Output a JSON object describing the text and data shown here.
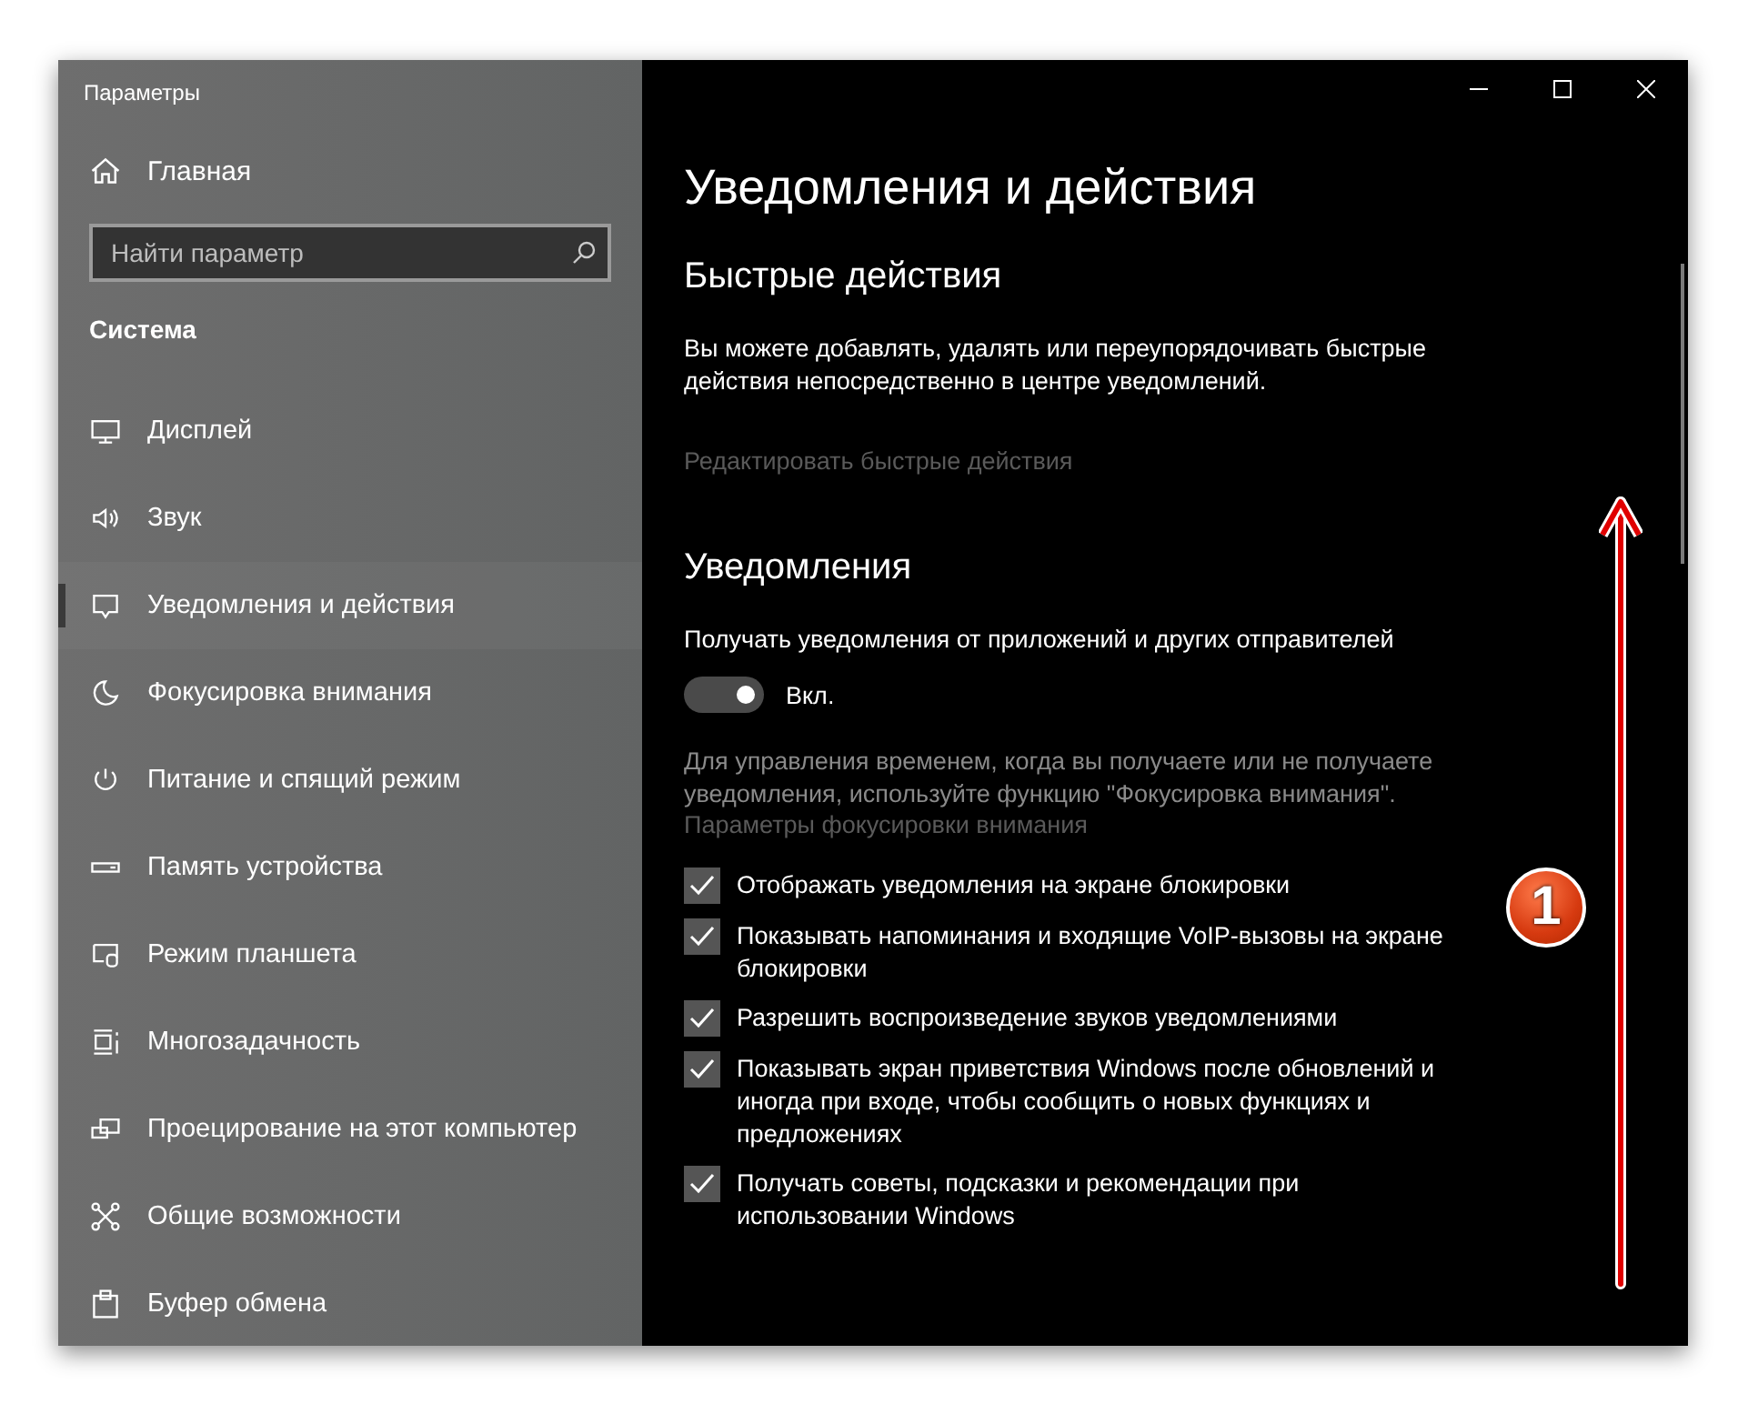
{
  "window": {
    "title": "Параметры"
  },
  "sidebar": {
    "home": "Главная",
    "search": {
      "placeholder": "Найти параметр"
    },
    "section": "Система",
    "items": [
      {
        "label": "Дисплей",
        "selected": false
      },
      {
        "label": "Звук",
        "selected": false
      },
      {
        "label": "Уведомления и действия",
        "selected": true
      },
      {
        "label": "Фокусировка внимания",
        "selected": false
      },
      {
        "label": "Питание и спящий режим",
        "selected": false
      },
      {
        "label": "Память устройства",
        "selected": false
      },
      {
        "label": "Режим планшета",
        "selected": false
      },
      {
        "label": "Многозадачность",
        "selected": false
      },
      {
        "label": "Проецирование на этот компьютер",
        "selected": false
      },
      {
        "label": "Общие возможности",
        "selected": false
      },
      {
        "label": "Буфер обмена",
        "selected": false
      }
    ]
  },
  "content": {
    "title": "Уведомления и действия",
    "quick_actions": {
      "heading": "Быстрые действия",
      "description": "Вы можете добавлять, удалять или переупорядочивать быстрые действия непосредственно в центре уведомлений.",
      "link": {
        "label": "Редактировать быстрые действия",
        "disabled": true
      }
    },
    "notifications": {
      "heading": "Уведомления",
      "toggle": {
        "label": "Получать уведомления от приложений и других отправителей",
        "on": true,
        "state_text": "Вкл."
      },
      "hint": "Для управления временем, когда вы получаете или не получаете уведомления, используйте функцию \"Фокусировка внимания\".",
      "link": {
        "label": "Параметры фокусировки внимания",
        "disabled": true
      },
      "checkboxes": [
        {
          "label": "Отображать уведомления на экране блокировки",
          "checked": true
        },
        {
          "label": "Показывать напоминания и входящие VoIP-вызовы на экране блокировки",
          "checked": true
        },
        {
          "label": "Разрешить  воспроизведение звуков уведомлениями",
          "checked": true
        },
        {
          "label": "Показывать экран приветствия Windows после обновлений и иногда при входе, чтобы сообщить о новых функциях и предложениях",
          "checked": true
        },
        {
          "label": "Получать советы, подсказки и рекомендации при использовании Windows",
          "checked": true
        }
      ]
    }
  },
  "annotation": {
    "badge": "1"
  }
}
